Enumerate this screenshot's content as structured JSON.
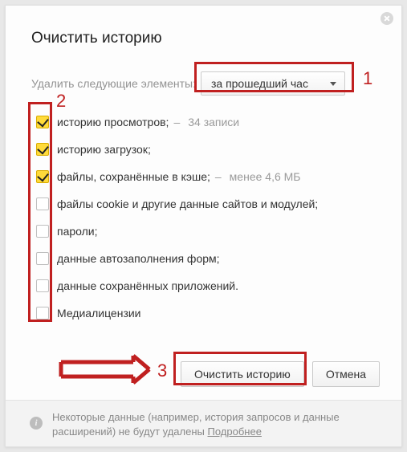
{
  "title": "Очистить историю",
  "range": {
    "label": "Удалить следующие элементы:",
    "selected": "за прошедший час"
  },
  "items": [
    {
      "label": "историю просмотров;",
      "suffix": "34 записи",
      "checked": true
    },
    {
      "label": "историю загрузок;",
      "suffix": "",
      "checked": true
    },
    {
      "label": "файлы, сохранённые в кэше;",
      "suffix": "менее 4,6 МБ",
      "checked": true
    },
    {
      "label": "файлы cookie и другие данные сайтов и модулей;",
      "suffix": "",
      "checked": false
    },
    {
      "label": "пароли;",
      "suffix": "",
      "checked": false
    },
    {
      "label": "данные автозаполнения форм;",
      "suffix": "",
      "checked": false
    },
    {
      "label": "данные сохранённых приложений.",
      "suffix": "",
      "checked": false
    },
    {
      "label": "Медиалицензии",
      "suffix": "",
      "checked": false
    }
  ],
  "buttons": {
    "clear": "Очистить историю",
    "cancel": "Отмена"
  },
  "footer": {
    "text": "Некоторые данные (например, история запросов и данные расширений) не будут удалены ",
    "link": "Подробнее"
  },
  "annotations": {
    "n1": "1",
    "n2": "2",
    "n3": "3"
  }
}
